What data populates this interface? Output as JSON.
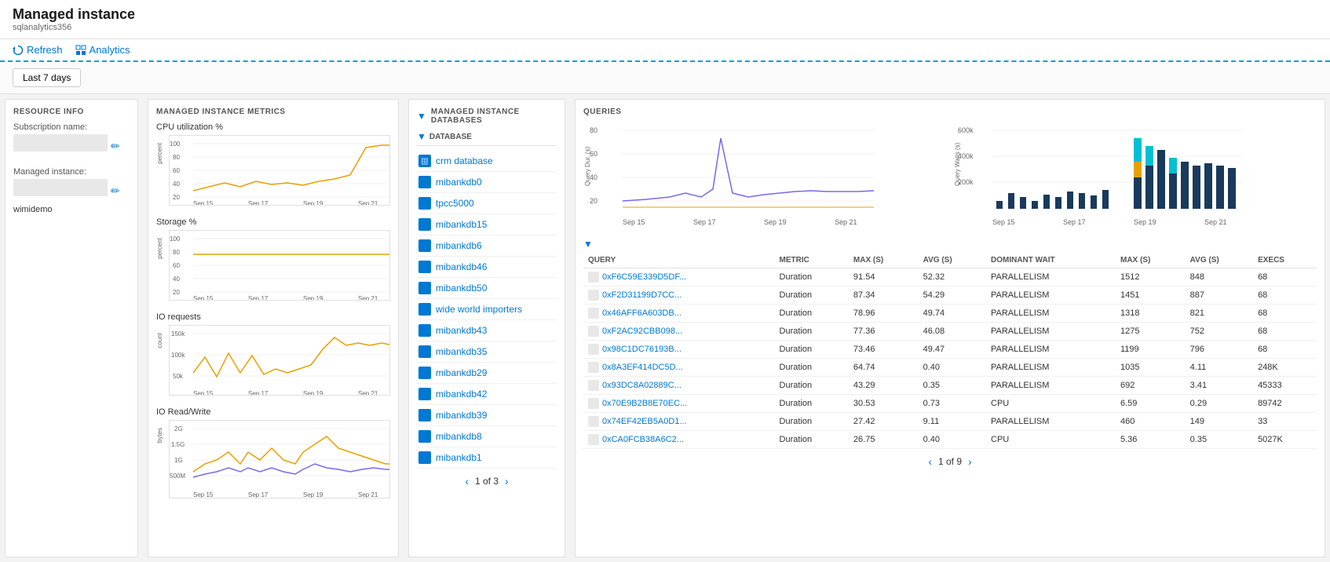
{
  "header": {
    "title": "Managed instance",
    "subtitle": "sqlanalytics356"
  },
  "toolbar": {
    "refresh_label": "Refresh",
    "analytics_label": "Analytics"
  },
  "filter": {
    "period_label": "Last 7 days"
  },
  "resource_info": {
    "section_title": "RESOURCE INFO",
    "subscription_label": "Subscription name:",
    "managed_instance_label": "Managed instance:",
    "managed_instance_value": "wimidemo"
  },
  "metrics": {
    "section_title": "MANAGED INSTANCE METRICS",
    "charts": [
      {
        "title": "CPU utilization %",
        "y_label": "percent",
        "dates": [
          "Sep 15",
          "Sep 17",
          "Sep 19",
          "Sep 21"
        ],
        "y_ticks": [
          "100",
          "80",
          "60",
          "40",
          "20"
        ]
      },
      {
        "title": "Storage %",
        "y_label": "percent",
        "dates": [
          "Sep 15",
          "Sep 17",
          "Sep 19",
          "Sep 21"
        ],
        "y_ticks": [
          "100",
          "80",
          "60",
          "40",
          "20"
        ]
      },
      {
        "title": "IO requests",
        "y_label": "count",
        "dates": [
          "Sep 15",
          "Sep 17",
          "Sep 19",
          "Sep 21"
        ],
        "y_ticks": [
          "150k",
          "100k",
          "50k"
        ]
      },
      {
        "title": "IO Read/Write",
        "y_label": "bytes",
        "dates": [
          "Sep 15",
          "Sep 17",
          "Sep 19",
          "Sep 21"
        ],
        "y_ticks": [
          "2G",
          "1.5G",
          "1G",
          "500M"
        ]
      }
    ]
  },
  "databases": {
    "section_title": "MANAGED INSTANCE DATABASES",
    "col_header": "DATABASE",
    "items": [
      "crm database",
      "mibankdb0",
      "tpcc5000",
      "mibankdb15",
      "mibankdb6",
      "mibankdb46",
      "mibankdb50",
      "wide world importers",
      "mibankdb43",
      "mibankdb35",
      "mibankdb29",
      "mibankdb42",
      "mibankdb39",
      "mibankdb8",
      "mibankdb1"
    ],
    "pagination": {
      "current": "1 of 3"
    }
  },
  "queries": {
    "section_title": "QUERIES",
    "charts": {
      "left": {
        "y_label": "Query Dur. (s)",
        "y_ticks": [
          "80",
          "60",
          "40",
          "20"
        ],
        "dates": [
          "Sep 15",
          "Sep 17",
          "Sep 19",
          "Sep 21"
        ]
      },
      "right": {
        "y_label": "Query Waits (s)",
        "y_ticks": [
          "600k",
          "400k",
          "200k"
        ],
        "dates": [
          "Sep 15",
          "Sep 17",
          "Sep 19",
          "Sep 21"
        ]
      }
    },
    "table": {
      "columns": [
        "QUERY",
        "METRIC",
        "MAX (S)",
        "AVG (S)",
        "DOMINANT WAIT",
        "MAX (S)",
        "AVG (S)",
        "EXECS"
      ],
      "rows": [
        {
          "id": "0xF6C59E339D5DF...",
          "metric": "Duration",
          "max": "91.54",
          "avg": "52.32",
          "dominant_wait": "PARALLELISM",
          "wait_max": "1512",
          "wait_avg": "848",
          "execs": "68"
        },
        {
          "id": "0xF2D31199D7CC...",
          "metric": "Duration",
          "max": "87.34",
          "avg": "54.29",
          "dominant_wait": "PARALLELISM",
          "wait_max": "1451",
          "wait_avg": "887",
          "execs": "68"
        },
        {
          "id": "0x46AFF6A603DB...",
          "metric": "Duration",
          "max": "78.96",
          "avg": "49.74",
          "dominant_wait": "PARALLELISM",
          "wait_max": "1318",
          "wait_avg": "821",
          "execs": "68"
        },
        {
          "id": "0xF2AC92CBB098...",
          "metric": "Duration",
          "max": "77.36",
          "avg": "46.08",
          "dominant_wait": "PARALLELISM",
          "wait_max": "1275",
          "wait_avg": "752",
          "execs": "68"
        },
        {
          "id": "0x98C1DC76193B...",
          "metric": "Duration",
          "max": "73.46",
          "avg": "49.47",
          "dominant_wait": "PARALLELISM",
          "wait_max": "1199",
          "wait_avg": "796",
          "execs": "68"
        },
        {
          "id": "0x8A3EF414DC5D...",
          "metric": "Duration",
          "max": "64.74",
          "avg": "0.40",
          "dominant_wait": "PARALLELISM",
          "wait_max": "1035",
          "wait_avg": "4.11",
          "execs": "248K"
        },
        {
          "id": "0x93DC8A02889C...",
          "metric": "Duration",
          "max": "43.29",
          "avg": "0.35",
          "dominant_wait": "PARALLELISM",
          "wait_max": "692",
          "wait_avg": "3.41",
          "execs": "45333"
        },
        {
          "id": "0x70E9B2B8E70EC...",
          "metric": "Duration",
          "max": "30.53",
          "avg": "0.73",
          "dominant_wait": "CPU",
          "wait_max": "6.59",
          "wait_avg": "0.29",
          "execs": "89742"
        },
        {
          "id": "0x74EF42EB5A0D1...",
          "metric": "Duration",
          "max": "27.42",
          "avg": "9.11",
          "dominant_wait": "PARALLELISM",
          "wait_max": "460",
          "wait_avg": "149",
          "execs": "33"
        },
        {
          "id": "0xCA0FCB38A6C2...",
          "metric": "Duration",
          "max": "26.75",
          "avg": "0.40",
          "dominant_wait": "CPU",
          "wait_max": "5.36",
          "wait_avg": "0.35",
          "execs": "5027K"
        }
      ],
      "pagination": {
        "current": "1 of 9"
      }
    }
  }
}
